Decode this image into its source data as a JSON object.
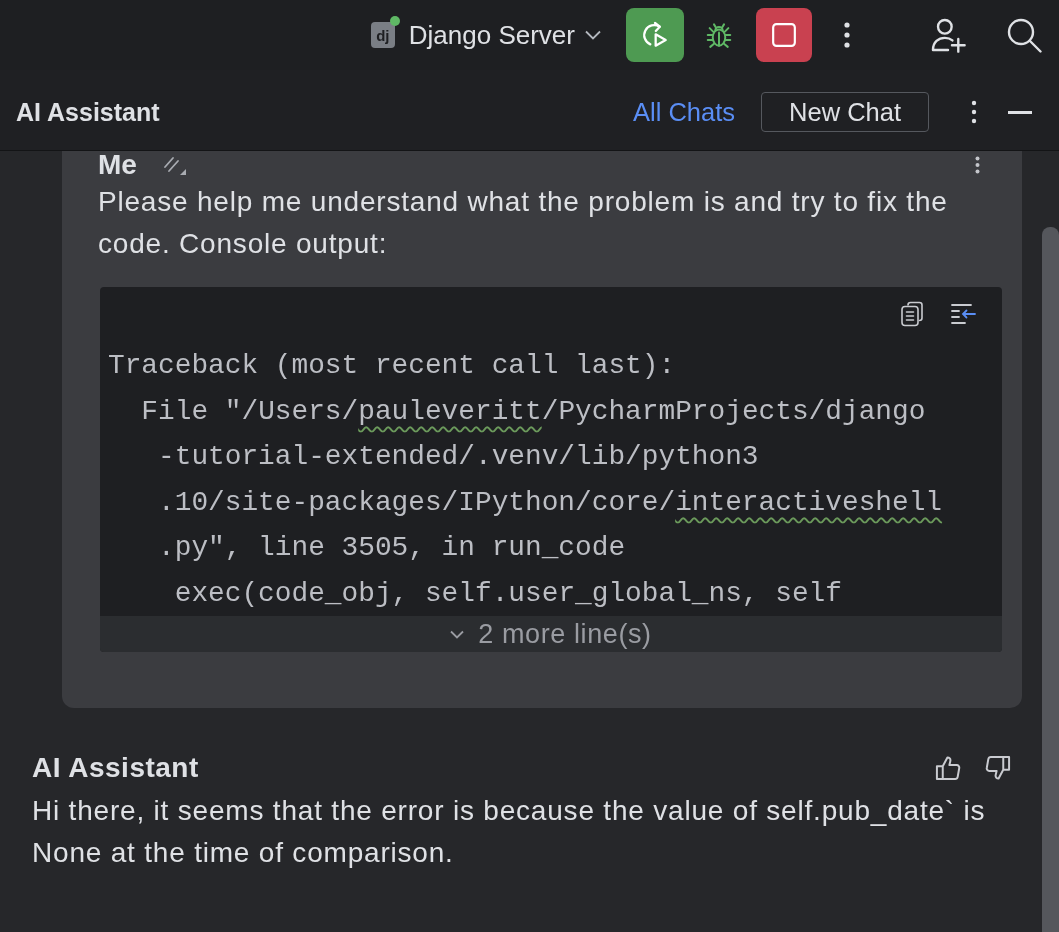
{
  "toolbar": {
    "run_configuration": {
      "logo": "dj",
      "running": true,
      "name": "Django Server"
    }
  },
  "header": {
    "title": "AI Assistant",
    "all_chats_link": "All Chats",
    "new_chat_button": "New Chat"
  },
  "user_message": {
    "author": "Me",
    "text": "Please help me understand what the problem is and try to fix the code. Console output:",
    "code": {
      "lines": [
        {
          "kind": "head",
          "segments": [
            {
              "text": "Traceback (most recent call last):",
              "flagged": false
            }
          ]
        },
        {
          "kind": "frame",
          "segments": [
            {
              "text": "File \"/Users/",
              "flagged": false
            },
            {
              "text": "pauleveritt",
              "flagged": true
            },
            {
              "text": "/PycharmProjects/django",
              "flagged": false
            }
          ]
        },
        {
          "kind": "wrap",
          "segments": [
            {
              "text": "-tutorial-extended/.venv/lib/python3",
              "flagged": false
            }
          ]
        },
        {
          "kind": "wrap",
          "segments": [
            {
              "text": ".10/site-packages/IPython/core/",
              "flagged": false
            },
            {
              "text": "interactiveshell",
              "flagged": true
            }
          ]
        },
        {
          "kind": "wrap",
          "segments": [
            {
              "text": ".py\", line 3505, in run_code",
              "flagged": false
            }
          ]
        },
        {
          "kind": "source",
          "segments": [
            {
              "text": "exec(code_obj, self.user_global_ns, self",
              "flagged": false
            }
          ]
        }
      ],
      "more_lines": "2 more line(s)"
    }
  },
  "assistant_message": {
    "author": "AI Assistant",
    "text": "Hi there, it seems that the error is because the value of self.pub_date` is None at the time of comparison."
  }
}
